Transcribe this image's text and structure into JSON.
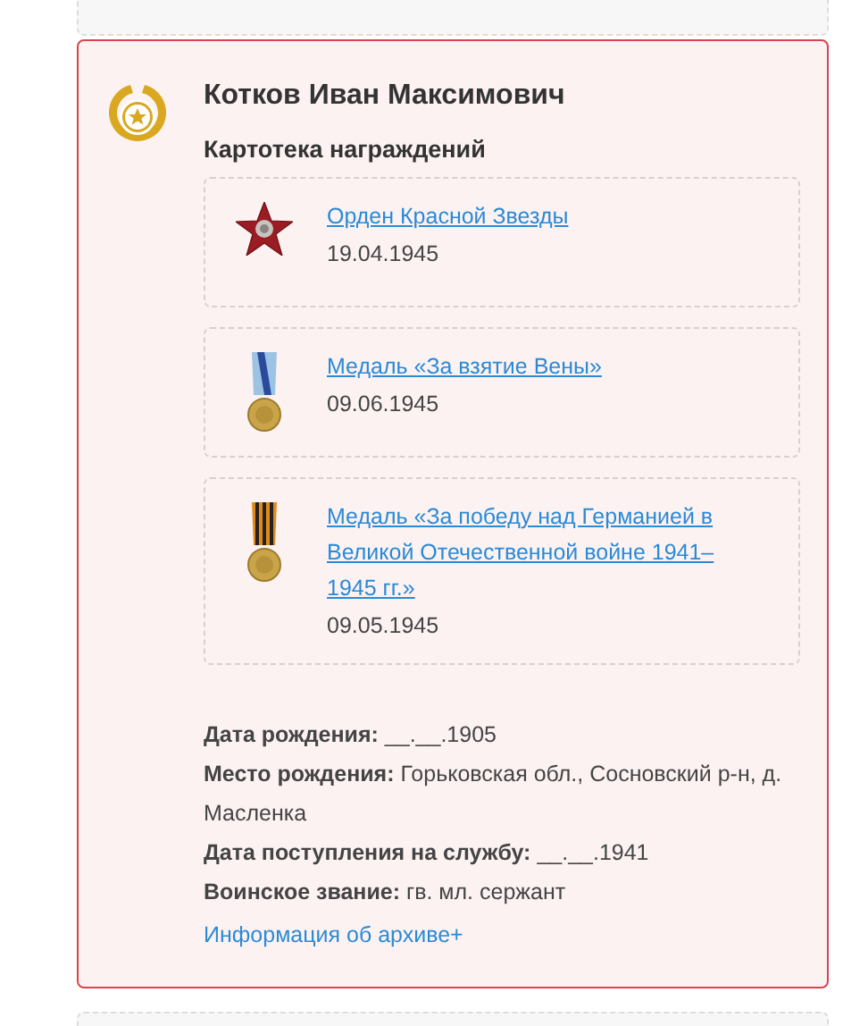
{
  "person": {
    "name": "Котков Иван Максимович",
    "section_title": "Картотека награждений"
  },
  "awards": [
    {
      "kind": "star",
      "title": "Орден Красной Звезды",
      "date": "19.04.1945"
    },
    {
      "kind": "blue-ribbon",
      "title": "Медаль «За взятие Вены»",
      "date": "09.06.1945"
    },
    {
      "kind": "striped-ribbon",
      "title": "Медаль «За победу над Германией в Великой Отечественной войне 1941–1945 гг.»",
      "date": "09.05.1945"
    }
  ],
  "details": [
    "**Дата рождения:** __.__.1905",
    "**Место рождения:** Горьковская обл., Сосновский р-н, д. Масленка",
    "**Дата поступления на службу:** __.__.1941",
    "**Воинское звание:** гв. мл. сержант"
  ],
  "archive_link": "Информация об архиве+"
}
